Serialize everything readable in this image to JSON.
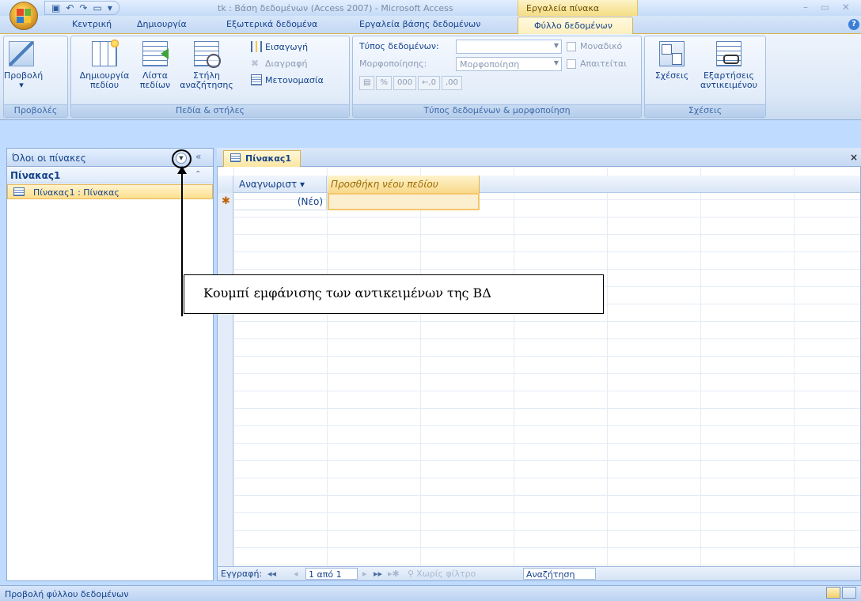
{
  "window": {
    "title": "tk : Βάση δεδομένων (Access 2007) - Microsoft Access",
    "context_tab": "Εργαλεία πίνακα",
    "controls": "– ▭ ✕"
  },
  "tabs": [
    {
      "label": "Κεντρική"
    },
    {
      "label": "Δημιουργία"
    },
    {
      "label": "Εξωτερικά δεδομένα"
    },
    {
      "label": "Εργαλεία βάσης δεδομένων"
    },
    {
      "label": "Φύλλο δεδομένων"
    }
  ],
  "ribbon": {
    "views": {
      "label": "Προβολές",
      "view_button": "Προβολή",
      "view_arrow": "▾"
    },
    "fields": {
      "label": "Πεδία & στήλες",
      "new_field": [
        "Δημιουργία",
        "πεδίου"
      ],
      "field_list": [
        "Λίστα",
        "πεδίων"
      ],
      "lookup_column": [
        "Στήλη",
        "αναζήτησης"
      ],
      "insert": "Εισαγωγή",
      "delete": "Διαγραφή",
      "rename": "Μετονομασία"
    },
    "datatype": {
      "label": "Τύπος δεδομένων & μορφοποίηση",
      "type_label": "Τύπος δεδομένων:",
      "type_value": "",
      "format_label": "Μορφοποίησης:",
      "format_value": "Μορφοποίηση",
      "unique": "Μοναδικό",
      "required": "Απαιτείται",
      "fmt_buttons": [
        "%",
        "000",
        "←,0",
        ",00"
      ]
    },
    "relations": {
      "label": "Σχέσεις",
      "relationships": "Σχέσεις",
      "dependencies": [
        "Εξαρτήσεις",
        "αντικειμένου"
      ]
    }
  },
  "nav": {
    "header": "Όλοι οι πίνακες",
    "shutter": "«",
    "group": "Πίνακας1",
    "collapse": "⌃",
    "item": "Πίνακας1 : Πίνακας"
  },
  "document": {
    "tab": "Πίνακας1",
    "close": "×",
    "columns": [
      "Αναγνωριστ ▾",
      "Προσθήκη νέου πεδίου"
    ],
    "new_row_marker": "✱",
    "new_row_value": "(Νέο)"
  },
  "record_nav": {
    "label": "Εγγραφή:",
    "first": "◂◂",
    "prev": "◂",
    "position": "1 από 1",
    "next": "▸",
    "last": "▸▸",
    "new": "▸✱",
    "filter": "Χωρίς φίλτρο",
    "search": "Αναζήτηση"
  },
  "status": {
    "text": "Προβολή φύλλου δεδομένων"
  },
  "annotation": {
    "text": "Κουμπί εμφάνισης των αντικειμένων της ΒΔ"
  }
}
